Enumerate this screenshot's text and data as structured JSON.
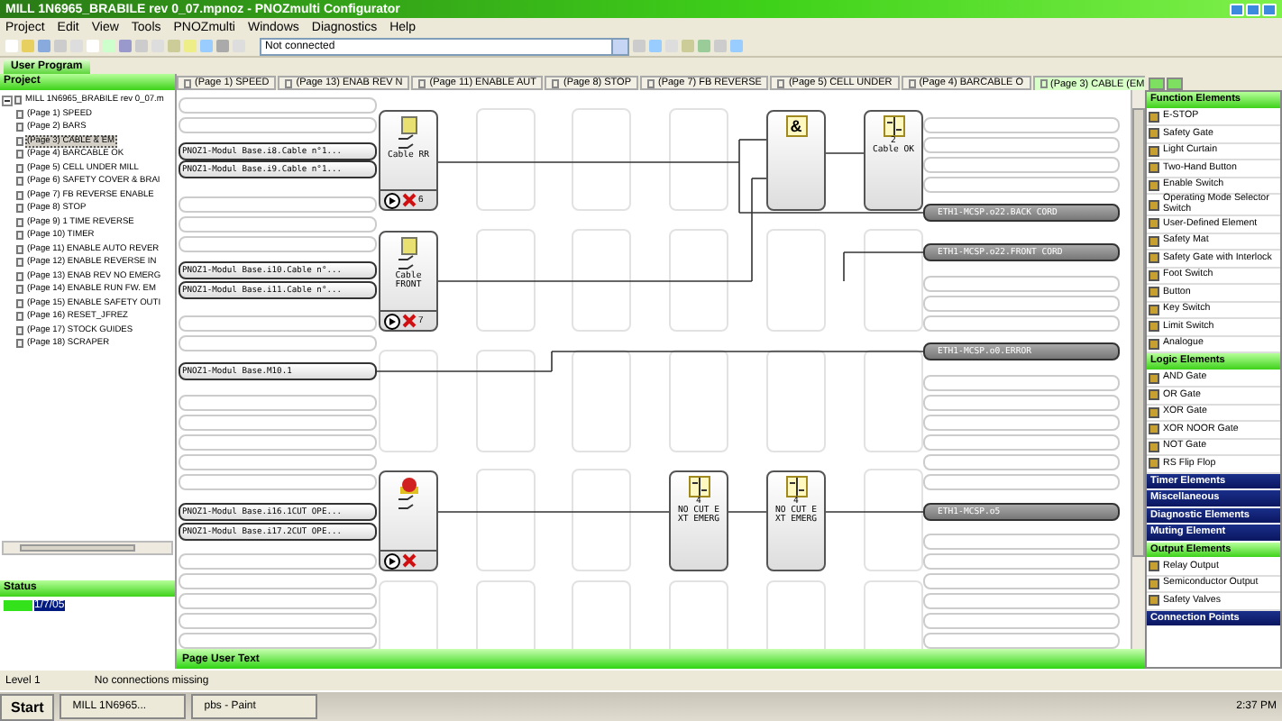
{
  "window": {
    "title": "MILL 1N6965_BRABILE rev 0_07.mpnoz - PNOZmulti Configurator"
  },
  "menu": [
    "Project",
    "Edit",
    "View",
    "Tools",
    "PNOZmulti",
    "Windows",
    "Diagnostics",
    "Help"
  ],
  "connection_select": {
    "value": "Not connected"
  },
  "program_tab": {
    "label": "User Program"
  },
  "page_tabs": [
    {
      "label": "(Page 1) SPEED",
      "selected": false
    },
    {
      "label": "(Page 13) ENAB REV N",
      "selected": false
    },
    {
      "label": "(Page 11) ENABLE AUT",
      "selected": false
    },
    {
      "label": "(Page 8) STOP",
      "selected": false
    },
    {
      "label": "(Page 7) FB REVERSE",
      "selected": false
    },
    {
      "label": "(Page 5) CELL UNDER",
      "selected": false
    },
    {
      "label": "(Page 4) BARCABLE O",
      "selected": false
    },
    {
      "label": "(Page 3) CABLE (EM",
      "selected": true
    }
  ],
  "project": {
    "title": "Project",
    "root": {
      "label": "MILL 1N6965_BRABILE rev 0_07.m",
      "expanded": true,
      "children": [
        {
          "label": "(Page 1) SPEED",
          "selected": false
        },
        {
          "label": "(Page 2) BARS",
          "selected": false
        },
        {
          "label": "(Page 3) CABLE & EM",
          "selected": true
        },
        {
          "label": "(Page 4) BARCABLE OK",
          "selected": false
        },
        {
          "label": "(Page 5) CELL UNDER MILL",
          "selected": false
        },
        {
          "label": "(Page 6) SAFETY COVER & BRAI",
          "selected": false
        },
        {
          "label": "(Page 7) FB REVERSE ENABLE",
          "selected": false
        },
        {
          "label": "(Page 8) STOP",
          "selected": false
        },
        {
          "label": "(Page 9) 1 TIME REVERSE",
          "selected": false
        },
        {
          "label": "(Page 10) TIMER",
          "selected": false
        },
        {
          "label": "(Page 11) ENABLE AUTO REVER",
          "selected": false
        },
        {
          "label": "(Page 12) ENABLE REVERSE IN",
          "selected": false
        },
        {
          "label": "(Page 13) ENAB REV NO EMERG",
          "selected": false
        },
        {
          "label": "(Page 14) ENABLE RUN FW. EM",
          "selected": false
        },
        {
          "label": "(Page 15) ENABLE SAFETY OUTI",
          "selected": false
        },
        {
          "label": "(Page 16) RESET_JFREZ",
          "selected": false
        },
        {
          "label": "(Page 17) STOCK GUIDES",
          "selected": false
        },
        {
          "label": "(Page 18) SCRAPER",
          "selected": false
        }
      ]
    }
  },
  "status_panel": {
    "title": "Status",
    "entry": "1/7/05"
  },
  "diagram": {
    "inputs": [
      "PNOZ1-Modul Base.i8.Cable n°1...",
      "PNOZ1-Modul Base.i9.Cable n°1...",
      "PNOZ1-Modul Base.i10.Cable n°...",
      "PNOZ1-Modul Base.i11.Cable n°...",
      "PNOZ1-Modul Base.M10.1",
      "PNOZ1-Modul Base.i16.1CUT OPE...",
      "PNOZ1-Modul Base.i17.2CUT OPE..."
    ],
    "blocks": [
      {
        "kind": "function",
        "lines": [
          "Cable RR"
        ],
        "number": "6"
      },
      {
        "kind": "function",
        "lines": [
          "Cable",
          "FRONT"
        ],
        "number": "7"
      },
      {
        "kind": "estop"
      },
      {
        "kind": "and",
        "symbol": "&"
      },
      {
        "kind": "element",
        "number": "2",
        "lines": [
          "Cable OK"
        ]
      },
      {
        "kind": "element",
        "number": "4",
        "lines": [
          "NO CUT E",
          "XT EMERG"
        ]
      },
      {
        "kind": "element",
        "number": "4",
        "lines": [
          "NO CUT E",
          "XT EMERG"
        ]
      }
    ],
    "outputs": [
      "ETH1-MCSP.o22.BACK CORD",
      "ETH1-MCSP.o22.FRONT CORD",
      "ETH1-MCSP.o0.ERROR",
      "ETH1-MCSP.o5"
    ],
    "footer": "Page User Text"
  },
  "palette": [
    {
      "kind": "green",
      "label": "Function Elements"
    },
    {
      "kind": "item",
      "label": "E-STOP"
    },
    {
      "kind": "item",
      "label": "Safety Gate"
    },
    {
      "kind": "item",
      "label": "Light Curtain"
    },
    {
      "kind": "item",
      "label": "Two-Hand Button"
    },
    {
      "kind": "item",
      "label": "Enable Switch"
    },
    {
      "kind": "item",
      "label": "Operating Mode Selector Switch"
    },
    {
      "kind": "item",
      "label": "User-Defined Element"
    },
    {
      "kind": "item",
      "label": "Safety Mat"
    },
    {
      "kind": "item",
      "label": "Safety Gate with Interlock"
    },
    {
      "kind": "item",
      "label": "Foot Switch"
    },
    {
      "kind": "item",
      "label": "Button"
    },
    {
      "kind": "item",
      "label": "Key Switch"
    },
    {
      "kind": "item",
      "label": "Limit Switch"
    },
    {
      "kind": "item",
      "label": "Analogue"
    },
    {
      "kind": "green",
      "label": "Logic Elements"
    },
    {
      "kind": "item",
      "label": "AND Gate"
    },
    {
      "kind": "item",
      "label": "OR Gate"
    },
    {
      "kind": "item",
      "label": "XOR Gate"
    },
    {
      "kind": "item",
      "label": "XOR NOOR Gate"
    },
    {
      "kind": "item",
      "label": "NOT Gate"
    },
    {
      "kind": "item",
      "label": "RS Flip Flop"
    },
    {
      "kind": "blue",
      "label": "Timer Elements"
    },
    {
      "kind": "blue",
      "label": "Miscellaneous"
    },
    {
      "kind": "blue",
      "label": "Diagnostic Elements"
    },
    {
      "kind": "blue",
      "label": "Muting Element"
    },
    {
      "kind": "green",
      "label": "Output Elements"
    },
    {
      "kind": "item",
      "label": "Relay Output"
    },
    {
      "kind": "item",
      "label": "Semiconductor Output"
    },
    {
      "kind": "item",
      "label": "Safety Valves"
    },
    {
      "kind": "blue",
      "label": "Connection Points"
    }
  ],
  "status_bar": {
    "level": "Level 1",
    "message": "No connections missing"
  },
  "taskbar": {
    "start": "Start",
    "tasks": [
      "MILL 1N6965...",
      "pbs - Paint"
    ],
    "clock": "2:37 PM"
  }
}
